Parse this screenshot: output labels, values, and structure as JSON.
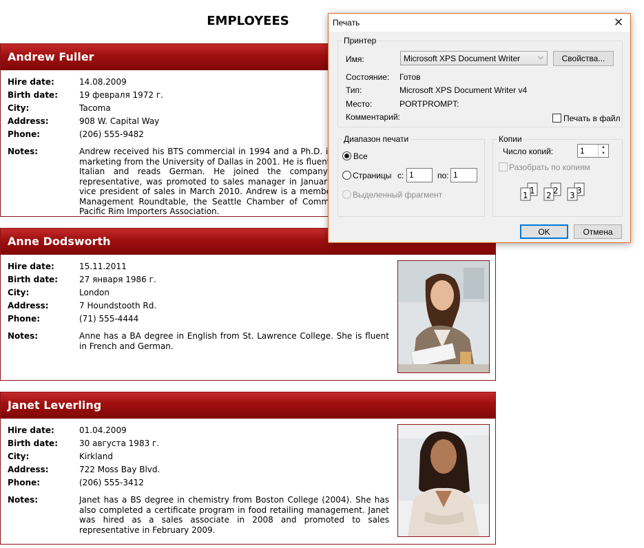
{
  "report": {
    "title": "EMPLOYEES",
    "labels": {
      "hire_date": "Hire date:",
      "birth_date": "Birth date:",
      "city": "City:",
      "address": "Address:",
      "phone": "Phone:",
      "notes": "Notes:"
    },
    "employees": [
      {
        "name": "Andrew Fuller",
        "hire_date": "14.08.2009",
        "birth_date": "19 февраля 1972 г.",
        "city": "Tacoma",
        "address": "908 W. Capital Way",
        "phone": "(206) 555-9482",
        "notes": "Andrew received his BTS commercial in 1994 and a Ph.D. in international marketing from the University of Dallas in 2001. He is fluent in French and Italian and reads German. He joined the company as a sales representative, was promoted to sales manager in January 2009 and to vice president of sales in March 2010. Andrew is a member of the Sales Management Roundtable, the Seattle Chamber of Commerce, and the Pacific Rim Importers Association."
      },
      {
        "name": "Anne Dodsworth",
        "hire_date": "15.11.2011",
        "birth_date": "27 января 1986 г.",
        "city": "London",
        "address": "7 Houndstooth Rd.",
        "phone": "(71) 555-4444",
        "notes": "Anne has a BA degree in English from St. Lawrence College. She is fluent in French and German."
      },
      {
        "name": "Janet Leverling",
        "hire_date": "01.04.2009",
        "birth_date": "30 августа 1983 г.",
        "city": "Kirkland",
        "address": "722 Moss Bay Blvd.",
        "phone": "(206) 555-3412",
        "notes": "Janet has a BS degree in chemistry from Boston College (2004). She has also completed a certificate program in food retailing management. Janet was hired as a sales associate in 2008 and promoted to sales representative in February 2009."
      }
    ]
  },
  "dialog": {
    "title": "Печать",
    "printer": {
      "group_label": "Принтер",
      "name_label": "Имя:",
      "name_value": "Microsoft XPS Document Writer",
      "properties_button": "Свойства...",
      "status_label": "Состояние:",
      "status_value": "Готов",
      "type_label": "Тип:",
      "type_value": "Microsoft XPS Document Writer v4",
      "location_label": "Место:",
      "location_value": "PORTPROMPT:",
      "comment_label": "Комментарий:",
      "print_to_file_label": "Печать в файл",
      "print_to_file_checked": false
    },
    "range": {
      "group_label": "Диапазон печати",
      "all_label": "Все",
      "pages_label": "Страницы",
      "from_label": "с:",
      "from_value": "1",
      "to_label": "по:",
      "to_value": "1",
      "selection_label": "Выделенный фрагмент",
      "selected": "all"
    },
    "copies": {
      "group_label": "Копии",
      "count_label": "Число копий:",
      "count_value": "1",
      "collate_label": "Разобрать по копиям",
      "collate_checked": false,
      "collate_digits": [
        "1",
        "1",
        "2",
        "2",
        "3",
        "3"
      ]
    },
    "ok_button": "OK",
    "cancel_button": "Отмена"
  }
}
